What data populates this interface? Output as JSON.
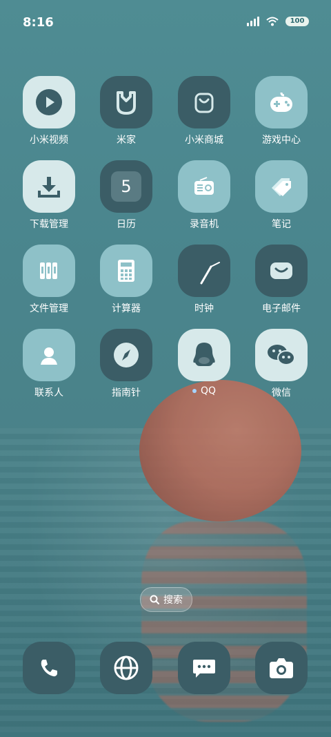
{
  "status_bar": {
    "time": "8:16",
    "battery": "100"
  },
  "apps": [
    {
      "label": "小米视频",
      "icon": "play-icon"
    },
    {
      "label": "米家",
      "icon": "mijia-icon"
    },
    {
      "label": "小米商城",
      "icon": "shopping-bag-icon"
    },
    {
      "label": "游戏中心",
      "icon": "gamepad-icon"
    },
    {
      "label": "下载管理",
      "icon": "download-icon"
    },
    {
      "label": "日历",
      "icon": "calendar-icon",
      "value": "5"
    },
    {
      "label": "录音机",
      "icon": "radio-icon"
    },
    {
      "label": "笔记",
      "icon": "tags-icon"
    },
    {
      "label": "文件管理",
      "icon": "binders-icon"
    },
    {
      "label": "计算器",
      "icon": "calculator-icon"
    },
    {
      "label": "时钟",
      "icon": "clock-icon"
    },
    {
      "label": "电子邮件",
      "icon": "mail-icon"
    },
    {
      "label": "联系人",
      "icon": "contact-icon"
    },
    {
      "label": "指南针",
      "icon": "compass-icon"
    },
    {
      "label": "QQ",
      "icon": "qq-penguin-icon",
      "badge_dot": true
    },
    {
      "label": "微信",
      "icon": "wechat-icon"
    }
  ],
  "search": {
    "label": "搜索",
    "icon": "search-icon"
  },
  "dock": [
    {
      "icon": "phone-icon"
    },
    {
      "icon": "browser-globe-icon"
    },
    {
      "icon": "messages-icon"
    },
    {
      "icon": "camera-icon"
    }
  ],
  "colors": {
    "tile_light": "#d7e9ea",
    "tile_dark": "#3b5d66",
    "tile_mid": "#8ec1c8",
    "wallpaper": "#4f8c93"
  }
}
